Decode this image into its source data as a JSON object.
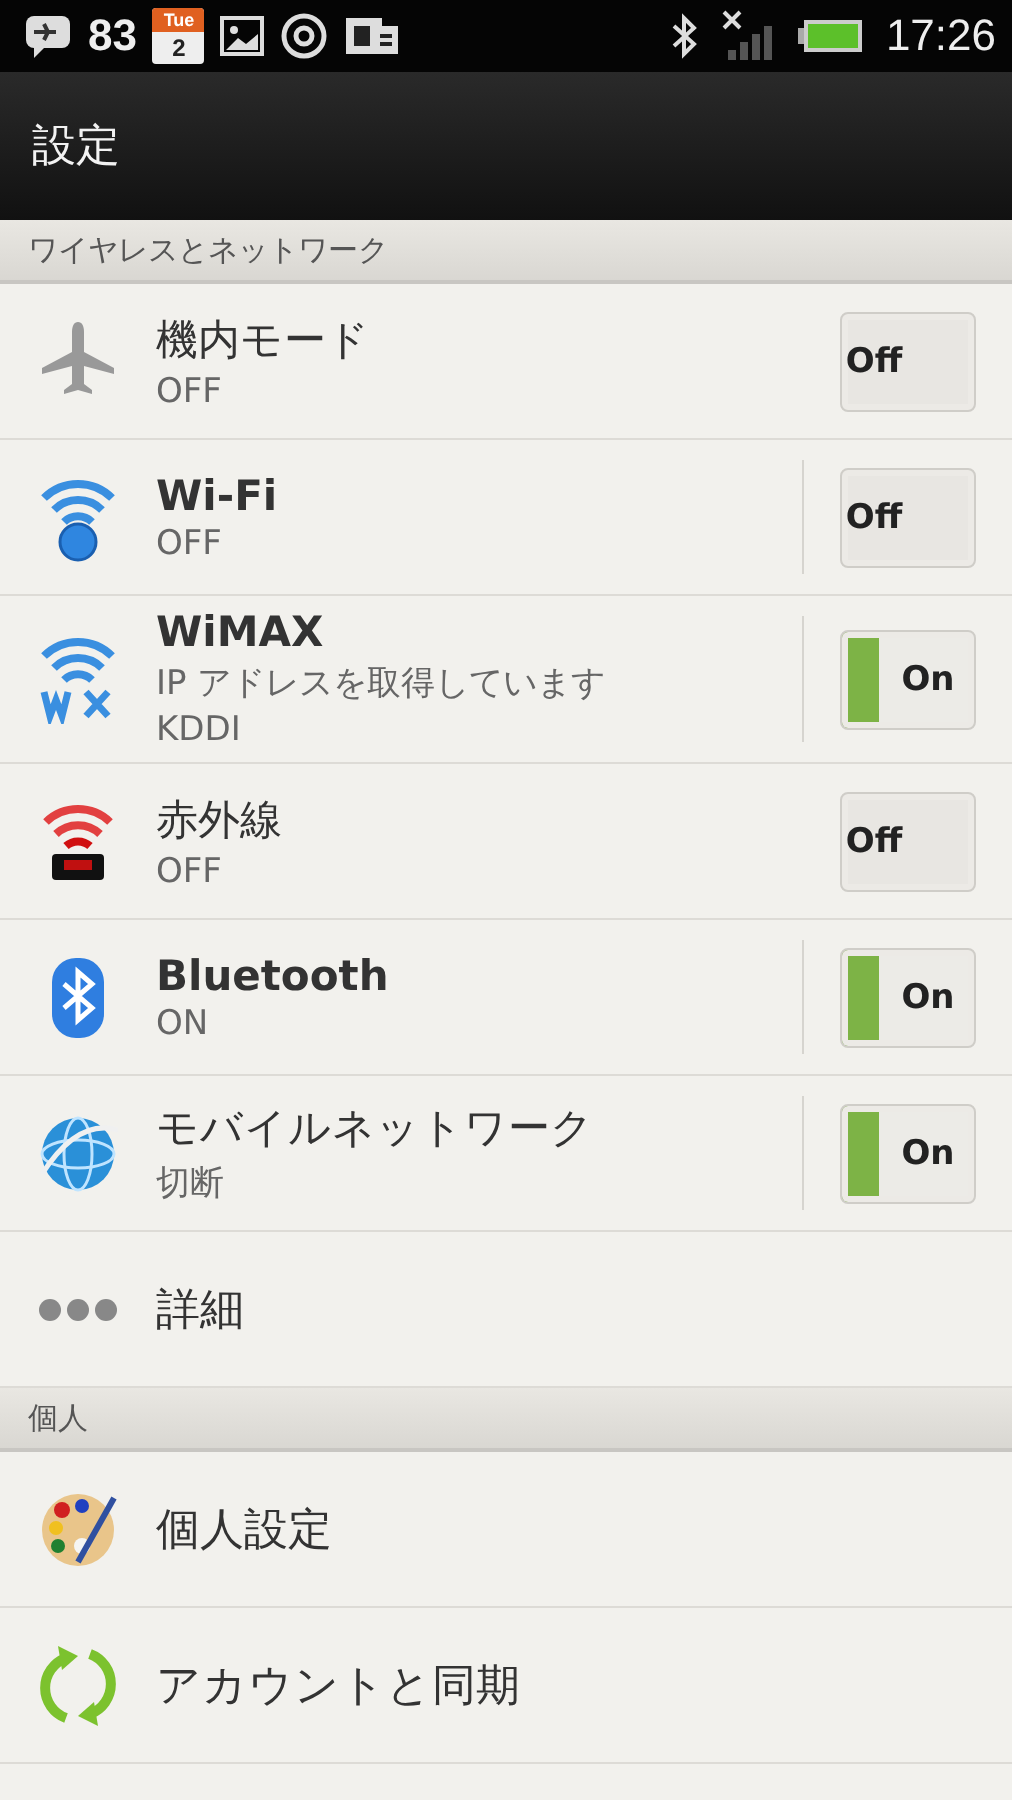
{
  "status_bar": {
    "notification_count": "83",
    "calendar_day": "Tue",
    "calendar_date": "2",
    "time": "17:26"
  },
  "title_bar": {
    "title": "設定"
  },
  "sections": [
    {
      "header": "ワイヤレスとネットワーク",
      "items": [
        {
          "kind": "toggle",
          "title": "機内モード",
          "title_bold": false,
          "summary": [
            "OFF"
          ],
          "split": false,
          "on": false,
          "toggle_label": "Off"
        },
        {
          "kind": "toggle",
          "title": "Wi-Fi",
          "title_bold": true,
          "summary": [
            "OFF"
          ],
          "split": true,
          "on": false,
          "toggle_label": "Off"
        },
        {
          "kind": "toggle",
          "title": "WiMAX",
          "title_bold": true,
          "summary": [
            "IP アドレスを取得しています",
            "KDDI"
          ],
          "split": true,
          "on": true,
          "toggle_label": "On"
        },
        {
          "kind": "toggle",
          "title": "赤外線",
          "title_bold": false,
          "summary": [
            "OFF"
          ],
          "split": false,
          "on": false,
          "toggle_label": "Off"
        },
        {
          "kind": "toggle",
          "title": "Bluetooth",
          "title_bold": true,
          "summary": [
            "ON"
          ],
          "split": true,
          "on": true,
          "toggle_label": "On"
        },
        {
          "kind": "toggle",
          "title": "モバイルネットワーク",
          "title_bold": false,
          "summary": [
            "切断"
          ],
          "split": true,
          "on": true,
          "toggle_label": "On"
        },
        {
          "kind": "plain",
          "title": "詳細",
          "title_bold": false
        }
      ]
    },
    {
      "header": "個人",
      "items": [
        {
          "kind": "plain",
          "title": "個人設定",
          "title_bold": false
        },
        {
          "kind": "plain",
          "title": "アカウントと同期",
          "title_bold": false
        }
      ]
    }
  ]
}
